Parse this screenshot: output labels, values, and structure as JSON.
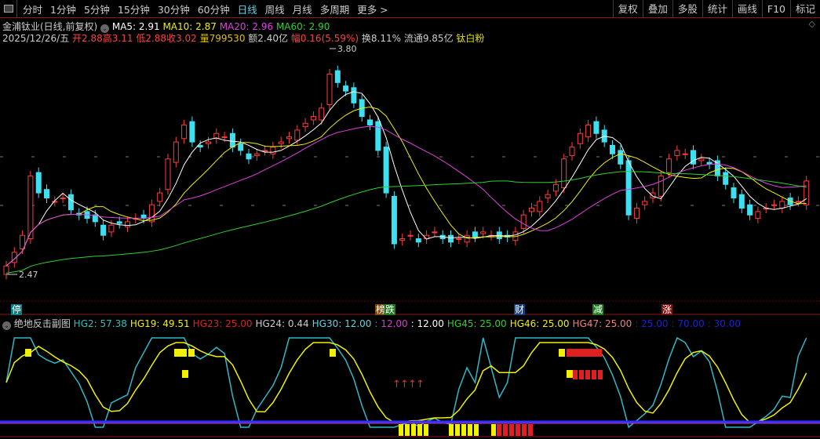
{
  "toolbar": {
    "periods": [
      "分时",
      "1分钟",
      "5分钟",
      "15分钟",
      "30分钟",
      "60分钟",
      "日线",
      "周线",
      "月线",
      "多周期",
      "更多 >"
    ],
    "active": "日线",
    "right_buttons": [
      "复权",
      "叠加",
      "多股",
      "统计",
      "画线",
      "F10",
      "标记"
    ]
  },
  "stock": {
    "title": "金浦钛业(日线,前复权)",
    "ma5": "MA5: 2.91",
    "ma10": "MA10: 2.87",
    "ma20": "MA20: 2.96",
    "ma60": "MA60: 2.90",
    "date": "2025/12/26/五",
    "open": "开2.88",
    "high": "高3.11",
    "low": "低2.88",
    "close": "收3.02",
    "volume": "量799530",
    "amount": "额2.40亿",
    "change": "幅0.16(5.59%)",
    "turnover": "换8.11%",
    "float": "流通9.85亿",
    "concept": "钛白粉"
  },
  "price_labels": {
    "high": "3.80",
    "low": "2.47"
  },
  "markers": [
    {
      "text": "停",
      "bg": "#0e7a80"
    },
    {
      "text": "榜",
      "bg": "#7a4a12"
    },
    {
      "text": "跌",
      "bg": "#1c7a1c"
    },
    {
      "text": "财",
      "bg": "#1a3f7a"
    },
    {
      "text": "减",
      "bg": "#1c7a1c"
    },
    {
      "text": "涨",
      "bg": "#7a1010"
    }
  ],
  "sub": {
    "title": "绝地反击副图",
    "items": [
      {
        "t": "HG2: 57.38",
        "c": "#2fc0c0"
      },
      {
        "t": "HG19: 49.51",
        "c": "#f0f000"
      },
      {
        "t": "HG23: 25.00",
        "c": "#e02020"
      },
      {
        "t": "HG24: 0.44",
        "c": "#ccc"
      },
      {
        "t": "HG30: 12.00",
        "c": "#5fd4e8"
      },
      {
        "t": ": 12.00",
        "c": "#d040d0"
      },
      {
        "t": ": 12.00",
        "c": "#fff"
      },
      {
        "t": "HG45: 25.00",
        "c": "#30d030"
      },
      {
        "t": "HG46: 25.00",
        "c": "#f0f000"
      },
      {
        "t": "HG47: 25.00",
        "c": "#f08080"
      },
      {
        "t": ": 25.00",
        "c": "#2020d0"
      },
      {
        "t": ": 70.00",
        "c": "#2020d0"
      },
      {
        "t": ": 30.00",
        "c": "#2020d0"
      }
    ]
  },
  "colors": {
    "up": "#ff3c3c",
    "down": "#3ce0f0",
    "ma5": "#ffffff",
    "ma10": "#f0f000",
    "ma20": "#e040e0",
    "ma60": "#30d030"
  },
  "chart_data": {
    "type": "candlestick",
    "ylim": [
      2.47,
      3.8
    ],
    "closes": [
      2.52,
      2.6,
      2.7,
      3.05,
      2.95,
      2.92,
      2.9,
      2.92,
      2.85,
      2.82,
      2.8,
      2.78,
      2.7,
      2.76,
      2.77,
      2.78,
      2.8,
      2.8,
      2.88,
      2.95,
      3.15,
      3.25,
      3.35,
      3.25,
      3.22,
      3.25,
      3.3,
      3.28,
      3.22,
      3.2,
      3.15,
      3.18,
      3.2,
      3.22,
      3.25,
      3.28,
      3.32,
      3.36,
      3.4,
      3.45,
      3.65,
      3.6,
      3.55,
      3.48,
      3.4,
      3.35,
      3.2,
      2.95,
      2.65,
      2.68,
      2.7,
      2.66,
      2.7,
      2.72,
      2.68,
      2.66,
      2.68,
      2.7,
      2.69,
      2.72,
      2.7,
      2.68,
      2.69,
      2.72,
      2.82,
      2.86,
      2.9,
      2.94,
      3.0,
      3.15,
      3.22,
      3.3,
      3.35,
      3.3,
      3.25,
      3.18,
      3.12,
      2.82,
      2.86,
      2.9,
      2.95,
      3.05,
      3.15,
      3.2,
      3.18,
      3.12,
      3.15,
      3.12,
      3.05,
      3.0,
      2.92,
      2.86,
      2.82,
      2.84,
      2.86,
      2.88,
      2.9,
      2.88,
      2.9,
      3.02
    ]
  }
}
